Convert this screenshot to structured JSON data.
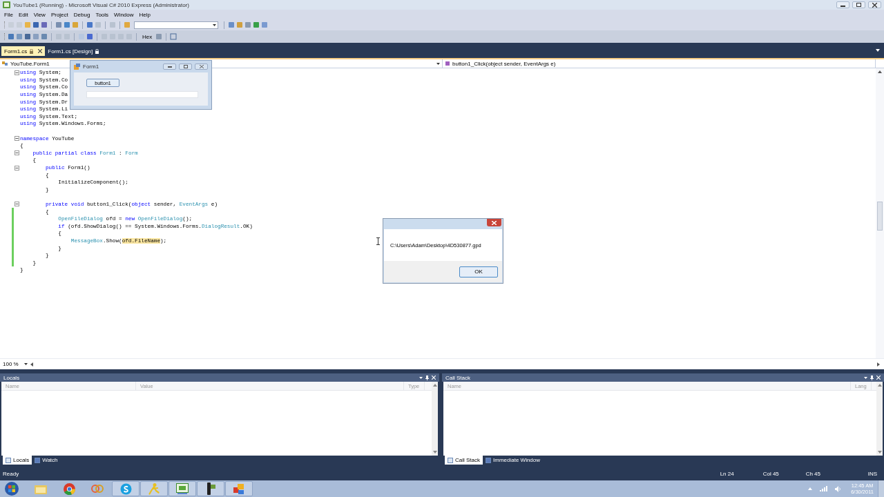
{
  "window": {
    "title": "YouTube1 (Running) - Microsoft Visual C# 2010 Express (Administrator)"
  },
  "menu": [
    "File",
    "Edit",
    "View",
    "Project",
    "Debug",
    "Tools",
    "Window",
    "Help"
  ],
  "toolbar": {
    "hex_label": "Hex"
  },
  "doc_tabs": [
    {
      "label": "Form1.cs",
      "selected": true
    },
    {
      "label": "Form1.cs [Design]",
      "selected": false
    }
  ],
  "nav": {
    "type_dropdown": "YouTube.Form1",
    "member_dropdown": "button1_Click(object sender, EventArgs e)"
  },
  "code_lines": [
    {
      "fold": true,
      "changed": false,
      "tokens": [
        {
          "text": "using",
          "kind": "keyword"
        },
        {
          "text": " System;",
          "kind": "plain"
        }
      ]
    },
    {
      "fold": false,
      "changed": false,
      "tokens": [
        {
          "text": "using",
          "kind": "keyword"
        },
        {
          "text": " System.Co",
          "kind": "plain"
        }
      ]
    },
    {
      "fold": false,
      "changed": false,
      "tokens": [
        {
          "text": "using",
          "kind": "keyword"
        },
        {
          "text": " System.Co",
          "kind": "plain"
        }
      ]
    },
    {
      "fold": false,
      "changed": false,
      "tokens": [
        {
          "text": "using",
          "kind": "keyword"
        },
        {
          "text": " System.Da",
          "kind": "plain"
        }
      ]
    },
    {
      "fold": false,
      "changed": false,
      "tokens": [
        {
          "text": "using",
          "kind": "keyword"
        },
        {
          "text": " System.Dr",
          "kind": "plain"
        }
      ]
    },
    {
      "fold": false,
      "changed": false,
      "tokens": [
        {
          "text": "using",
          "kind": "keyword"
        },
        {
          "text": " System.Li",
          "kind": "plain"
        }
      ]
    },
    {
      "fold": false,
      "changed": false,
      "tokens": [
        {
          "text": "using",
          "kind": "keyword"
        },
        {
          "text": " System.Text;",
          "kind": "plain"
        }
      ]
    },
    {
      "fold": false,
      "changed": false,
      "tokens": [
        {
          "text": "using",
          "kind": "keyword"
        },
        {
          "text": " System.Windows.Forms;",
          "kind": "plain"
        }
      ]
    },
    {
      "fold": false,
      "changed": false
    },
    {
      "fold": true,
      "changed": false,
      "tokens": [
        {
          "text": "namespace",
          "kind": "keyword"
        },
        {
          "text": " YouTube",
          "kind": "plain"
        }
      ]
    },
    {
      "fold": false,
      "changed": false,
      "tokens": [
        {
          "text": "{",
          "kind": "plain"
        }
      ]
    },
    {
      "fold": true,
      "changed": false,
      "tokens": [
        {
          "text": "    public partial class ",
          "kind": "keyword"
        },
        {
          "text": "Form1",
          "kind": "type"
        },
        {
          "text": " : ",
          "kind": "plain"
        },
        {
          "text": "Form",
          "kind": "type"
        }
      ]
    },
    {
      "fold": false,
      "changed": false,
      "tokens": [
        {
          "text": "    {",
          "kind": "plain"
        }
      ]
    },
    {
      "fold": true,
      "changed": false,
      "tokens": [
        {
          "text": "        public",
          "kind": "keyword"
        },
        {
          "text": " Form1()",
          "kind": "plain"
        }
      ]
    },
    {
      "fold": false,
      "changed": false,
      "tokens": [
        {
          "text": "        {",
          "kind": "plain"
        }
      ]
    },
    {
      "fold": false,
      "changed": false,
      "tokens": [
        {
          "text": "            InitializeComponent();",
          "kind": "plain"
        }
      ]
    },
    {
      "fold": false,
      "changed": false,
      "tokens": [
        {
          "text": "        }",
          "kind": "plain"
        }
      ]
    },
    {
      "fold": false,
      "changed": false
    },
    {
      "fold": true,
      "changed": false,
      "tokens": [
        {
          "text": "        private void",
          "kind": "keyword"
        },
        {
          "text": " button1_Click(",
          "kind": "plain"
        },
        {
          "text": "object",
          "kind": "keyword"
        },
        {
          "text": " sender, ",
          "kind": "plain"
        },
        {
          "text": "EventArgs",
          "kind": "type"
        },
        {
          "text": " e)",
          "kind": "plain"
        }
      ]
    },
    {
      "fold": false,
      "changed": true,
      "tokens": [
        {
          "text": "        {",
          "kind": "plain"
        }
      ]
    },
    {
      "fold": false,
      "changed": true,
      "tokens": [
        {
          "text": "            OpenFileDialog",
          "kind": "type"
        },
        {
          "text": " ofd = ",
          "kind": "plain"
        },
        {
          "text": "new ",
          "kind": "keyword"
        },
        {
          "text": "OpenFileDialog",
          "kind": "type"
        },
        {
          "text": "();",
          "kind": "plain"
        }
      ]
    },
    {
      "fold": false,
      "changed": true,
      "tokens": [
        {
          "text": "            if",
          "kind": "keyword"
        },
        {
          "text": " (ofd.ShowDialog() == System.Windows.Forms.",
          "kind": "plain"
        },
        {
          "text": "DialogResult",
          "kind": "type"
        },
        {
          "text": ".OK)",
          "kind": "plain"
        }
      ]
    },
    {
      "fold": false,
      "changed": true,
      "tokens": [
        {
          "text": "            {",
          "kind": "plain"
        }
      ]
    },
    {
      "fold": false,
      "changed": true,
      "tokens": [
        {
          "text": "                MessageBox",
          "kind": "type"
        },
        {
          "text": ".Show(",
          "kind": "plain"
        },
        {
          "text": "ofd.FileName",
          "kind": "highlight"
        },
        {
          "text": ");",
          "kind": "plain"
        }
      ]
    },
    {
      "fold": false,
      "changed": true,
      "tokens": [
        {
          "text": "            }",
          "kind": "plain"
        }
      ]
    },
    {
      "fold": false,
      "changed": true,
      "tokens": [
        {
          "text": "        }",
          "kind": "plain"
        }
      ]
    },
    {
      "fold": false,
      "changed": true,
      "tokens": [
        {
          "text": "    }",
          "kind": "plain"
        }
      ]
    },
    {
      "fold": false,
      "changed": false,
      "tokens": [
        {
          "text": "}",
          "kind": "plain"
        }
      ]
    }
  ],
  "form_window": {
    "title": "Form1",
    "button": "button1"
  },
  "message_box": {
    "text": "C:\\Users\\Adam\\Desktop\\4D530877.gpd",
    "button": "OK"
  },
  "zoom": "100 %",
  "panels": [
    {
      "title": "Locals",
      "columns": [
        "Name",
        "Value",
        "Type"
      ],
      "tabs": [
        {
          "label": "Locals",
          "selected": true
        },
        {
          "label": "Watch",
          "selected": false
        }
      ]
    },
    {
      "title": "Call Stack",
      "columns": [
        "Name",
        "Lang"
      ],
      "tabs": [
        {
          "label": "Call Stack",
          "selected": true
        },
        {
          "label": "Immediate Window",
          "selected": false
        }
      ]
    }
  ],
  "status_bar": {
    "text": "Ready",
    "line": "Ln 24",
    "col": "Col 45",
    "ch": "Ch 45",
    "mode": "INS"
  },
  "taskbar": {
    "time": "12:45 AM",
    "date": "6/30/2011"
  }
}
